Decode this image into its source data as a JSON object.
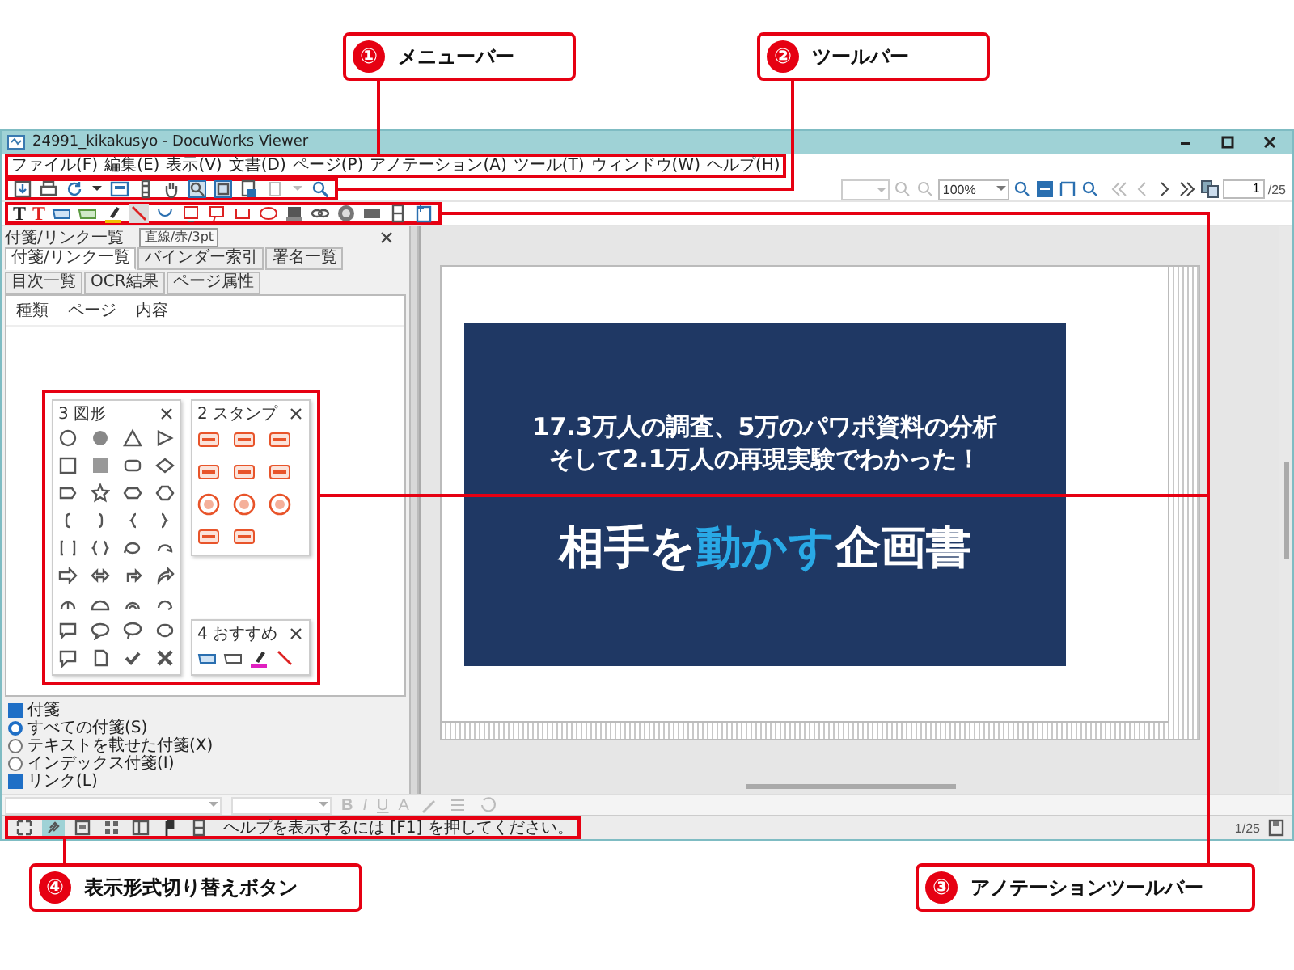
{
  "callouts": [
    {
      "number": "①",
      "label": "メニューバー"
    },
    {
      "number": "②",
      "label": "ツールバー"
    },
    {
      "number": "④",
      "label": "表示形式切り替えボタン"
    },
    {
      "number": "③",
      "label": "アノテーションツールバー"
    }
  ],
  "window": {
    "title": "24991_kikakusyo - DocuWorks Viewer",
    "menu": [
      "ファイル(F)",
      "編集(E)",
      "表示(V)",
      "文書(D)",
      "ページ(P)",
      "アノテーション(A)",
      "ツール(T)",
      "ウィンドウ(W)",
      "ヘルプ(H)"
    ],
    "toolbar": {
      "zoom": "100%",
      "page": "1",
      "page_total": "/25"
    },
    "text_tools": [
      {
        "glyph": "T",
        "color": "#222222"
      },
      {
        "glyph": "T",
        "color": "#e02020"
      }
    ],
    "tooltip": "直線/赤/3pt"
  },
  "left_panel": {
    "title": "付箋/リンク一覧",
    "tabs": [
      {
        "label": "付箋/リンク一覧",
        "selected": true
      },
      {
        "label": "バインダー索引",
        "selected": false
      },
      {
        "label": "署名一覧",
        "selected": false
      },
      {
        "label": "目次一覧",
        "selected": false
      },
      {
        "label": "OCR結果",
        "selected": false
      },
      {
        "label": "ページ属性",
        "selected": false
      }
    ],
    "columns": [
      "種類",
      "ページ",
      "内容"
    ],
    "palettes": [
      {
        "title": "3 図形",
        "kind": "shapes"
      },
      {
        "title": "2 スタンプ",
        "kind": "stamps"
      },
      {
        "title": "4 おすすめ",
        "kind": "favorites"
      }
    ],
    "filters": [
      {
        "kind": "checkbox",
        "label": "付箋",
        "checked": true
      },
      {
        "kind": "radio",
        "label": "すべての付箋(S)",
        "selected": true
      },
      {
        "kind": "radio",
        "label": "テキストを載せた付箋(X)",
        "selected": false
      },
      {
        "kind": "radio",
        "label": "インデックス付箋(I)",
        "selected": false
      },
      {
        "kind": "checkbox",
        "label": "リンク(L)",
        "checked": true
      }
    ]
  },
  "document": {
    "lines": [
      "17.3万人の調査、5万のパワポ資料の分析",
      "そして2.1万人の再現実験でわかった！"
    ],
    "title_parts": [
      {
        "text": "相手を",
        "highlight": false
      },
      {
        "text": "動かす",
        "highlight": true
      },
      {
        "text": "企画書",
        "highlight": false
      }
    ]
  },
  "format_bar": [
    "B",
    "I",
    "U",
    "A"
  ],
  "status_bar": {
    "view_buttons": [
      {
        "selected": false
      },
      {
        "selected": true
      },
      {
        "selected": false
      },
      {
        "selected": false
      },
      {
        "selected": false
      },
      {
        "selected": false
      },
      {
        "selected": false
      }
    ],
    "help": "ヘルプを表示するには [F1] を押してください。",
    "page": "1/25"
  }
}
